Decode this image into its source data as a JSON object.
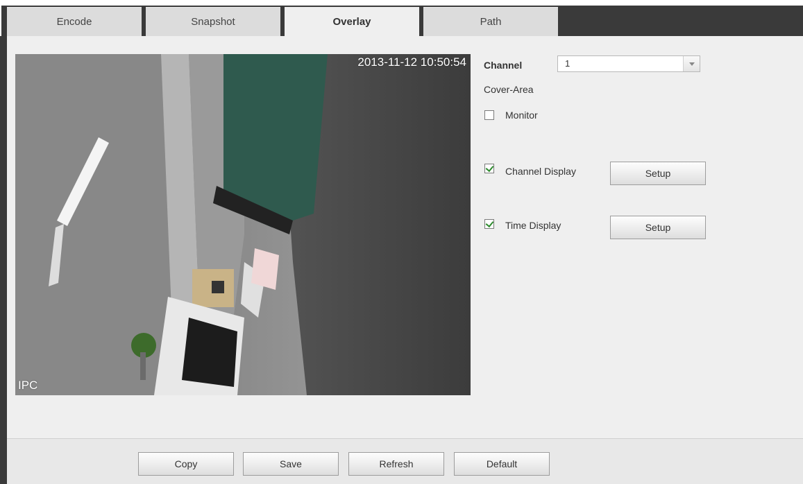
{
  "tabs": [
    {
      "label": "Encode"
    },
    {
      "label": "Snapshot"
    },
    {
      "label": "Overlay"
    },
    {
      "label": "Path"
    }
  ],
  "active_tab": "Overlay",
  "video": {
    "timestamp": "2013-11-12 10:50:54",
    "channel_name": "IPC"
  },
  "settings": {
    "channel_label": "Channel",
    "channel_value": "1",
    "cover_area_label": "Cover-Area",
    "monitor_label": "Monitor",
    "monitor_checked": false,
    "channel_display_label": "Channel Display",
    "channel_display_checked": true,
    "channel_display_setup": "Setup",
    "time_display_label": "Time Display",
    "time_display_checked": true,
    "time_display_setup": "Setup"
  },
  "footer": {
    "copy": "Copy",
    "save": "Save",
    "refresh": "Refresh",
    "default": "Default"
  },
  "colors": {
    "frame_dark": "#3a3a3a",
    "panel_bg": "#efefef",
    "check_green": "#2e8b2e"
  }
}
